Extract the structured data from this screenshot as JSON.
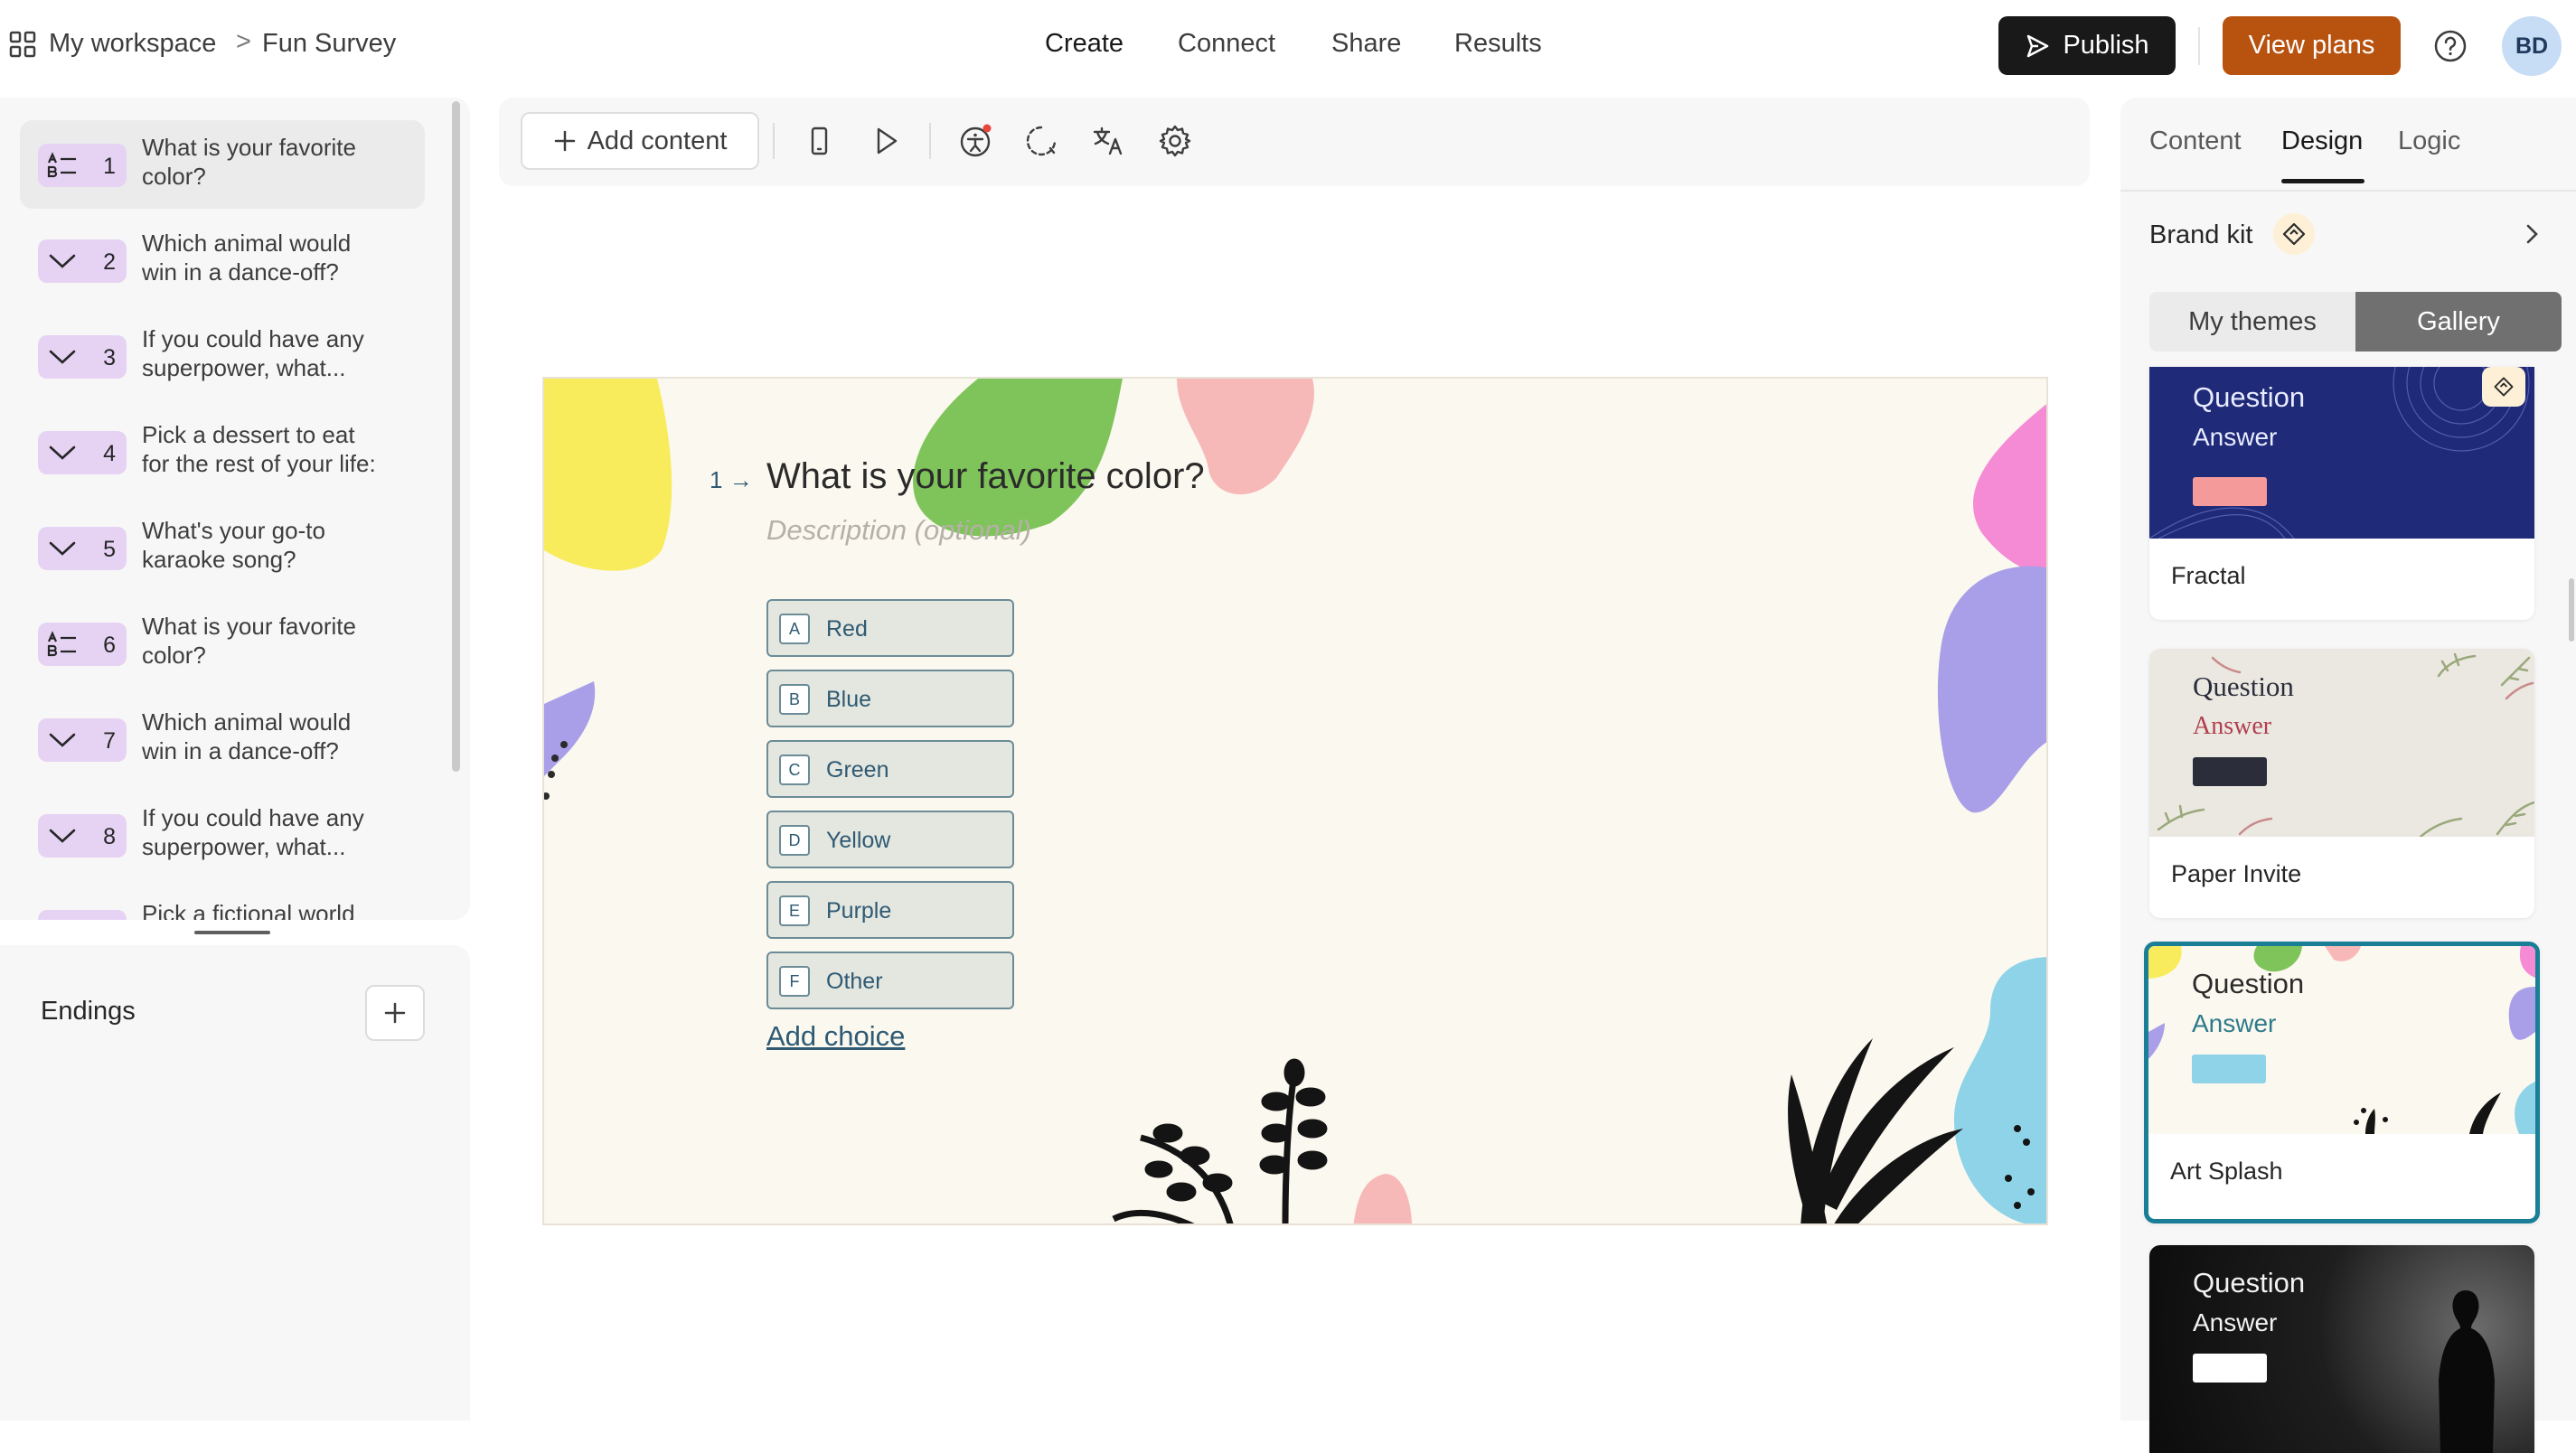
{
  "breadcrumb": {
    "workspace": "My workspace",
    "separator": ">",
    "form": "Fun Survey"
  },
  "nav": {
    "tabs": [
      {
        "label": "Create"
      },
      {
        "label": "Connect"
      },
      {
        "label": "Share"
      },
      {
        "label": "Results"
      }
    ],
    "active": "Create"
  },
  "header": {
    "publish_label": "Publish",
    "plans_label": "View plans",
    "avatar_initials": "BD"
  },
  "questions": [
    {
      "num": "1",
      "line1": "What is your favorite",
      "line2": "color?",
      "icon": "list-choice-icon"
    },
    {
      "num": "2",
      "line1": "Which animal would",
      "line2": "win in a dance-off?",
      "icon": "chevron-down-icon"
    },
    {
      "num": "3",
      "line1": "If you could have any",
      "line2": "superpower, what...",
      "icon": "chevron-down-icon"
    },
    {
      "num": "4",
      "line1": "Pick a dessert to eat",
      "line2": "for the rest of your life:",
      "icon": "chevron-down-icon"
    },
    {
      "num": "5",
      "line1": "What's your go-to",
      "line2": "karaoke song?",
      "icon": "chevron-down-icon"
    },
    {
      "num": "6",
      "line1": "What is your favorite",
      "line2": "color?",
      "icon": "list-choice-icon"
    },
    {
      "num": "7",
      "line1": "Which animal would",
      "line2": "win in a dance-off?",
      "icon": "chevron-down-icon"
    },
    {
      "num": "8",
      "line1": "If you could have any",
      "line2": "superpower, what...",
      "icon": "chevron-down-icon"
    },
    {
      "num": "",
      "line1": "Pick a fictional world",
      "line2": "",
      "icon": "chevron-down-icon"
    }
  ],
  "endings": {
    "label": "Endings"
  },
  "toolbar": {
    "add_content_label": "Add content"
  },
  "canvas": {
    "question_number": "1",
    "question_title": "What is your favorite color?",
    "description_placeholder": "Description (optional)",
    "choices": [
      {
        "key": "A",
        "label": "Red"
      },
      {
        "key": "B",
        "label": "Blue"
      },
      {
        "key": "C",
        "label": "Green"
      },
      {
        "key": "D",
        "label": "Yellow"
      },
      {
        "key": "E",
        "label": "Purple"
      },
      {
        "key": "F",
        "label": "Other"
      }
    ],
    "add_choice_label": "Add choice"
  },
  "right_panel": {
    "tabs": [
      {
        "label": "Content"
      },
      {
        "label": "Design"
      },
      {
        "label": "Logic"
      }
    ],
    "active_tab": "Design",
    "brand_kit_label": "Brand kit",
    "segment": {
      "my_themes": "My themes",
      "gallery": "Gallery",
      "active": "Gallery"
    },
    "themes": [
      {
        "name": "Fractal",
        "question": "Question",
        "answer": "Answer"
      },
      {
        "name": "Paper Invite",
        "question": "Question",
        "answer": "Answer"
      },
      {
        "name": "Art Splash",
        "question": "Question",
        "answer": "Answer",
        "selected": true
      },
      {
        "name": "",
        "question": "Question",
        "answer": "Answer"
      }
    ]
  },
  "colors": {
    "accent_selected": "#1a7f96",
    "publish_bg": "#191919",
    "plans_bg": "#b8520f",
    "question_badge": "#e6d3f4",
    "canvas_bg": "#fbf8ef",
    "choice_text": "#2e5a73"
  }
}
